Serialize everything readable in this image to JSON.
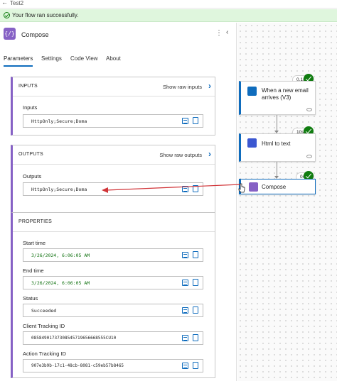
{
  "window": {
    "title": "Test2",
    "back_glyph": "←"
  },
  "banner": {
    "message": "Your flow ran successfully."
  },
  "panel": {
    "title": "Compose",
    "icon_glyph": "{/}",
    "tabs": [
      {
        "label": "Parameters",
        "active": true
      },
      {
        "label": "Settings",
        "active": false
      },
      {
        "label": "Code View",
        "active": false
      },
      {
        "label": "About",
        "active": false
      }
    ],
    "inputs_card": {
      "header": "INPUTS",
      "raw_label": "Show raw inputs",
      "field_label": "Inputs",
      "field_value": "HttpOnly;Secure;Doma"
    },
    "outputs_card": {
      "header": "OUTPUTS",
      "raw_label": "Show raw outputs",
      "field_label": "Outputs",
      "field_value": "HttpOnly;Secure;Doma"
    },
    "properties_card": {
      "header": "PROPERTIES",
      "fields": [
        {
          "label": "Start time",
          "value": "3/26/2024, 6:06:05 AM"
        },
        {
          "label": "End time",
          "value": "3/26/2024, 6:06:05 AM"
        },
        {
          "label": "Status",
          "value": "Succeeded"
        },
        {
          "label": "Client Tracking ID",
          "value": "08584901737308545719656668555CU10"
        },
        {
          "label": "Action Tracking ID",
          "value": "907e3b9b-17c1-48cb-8081-c59eb57b8465"
        }
      ]
    }
  },
  "canvas": {
    "nodes": [
      {
        "label_line1": "When a new email",
        "label_line2": "arrives (V3)",
        "duration": "0.1s",
        "icon_color": "#0f6cbd"
      },
      {
        "label_line1": "Html to text",
        "label_line2": "",
        "duration": "10s",
        "icon_color": "#3b57d1"
      },
      {
        "label_line1": "Compose",
        "label_line2": "",
        "duration": "0s",
        "icon_color": "#8661c5"
      }
    ]
  },
  "colors": {
    "accent": "#0f6cbd",
    "compose": "#8661c5",
    "success": "#107c10",
    "annotation_arrow": "#d13438"
  }
}
